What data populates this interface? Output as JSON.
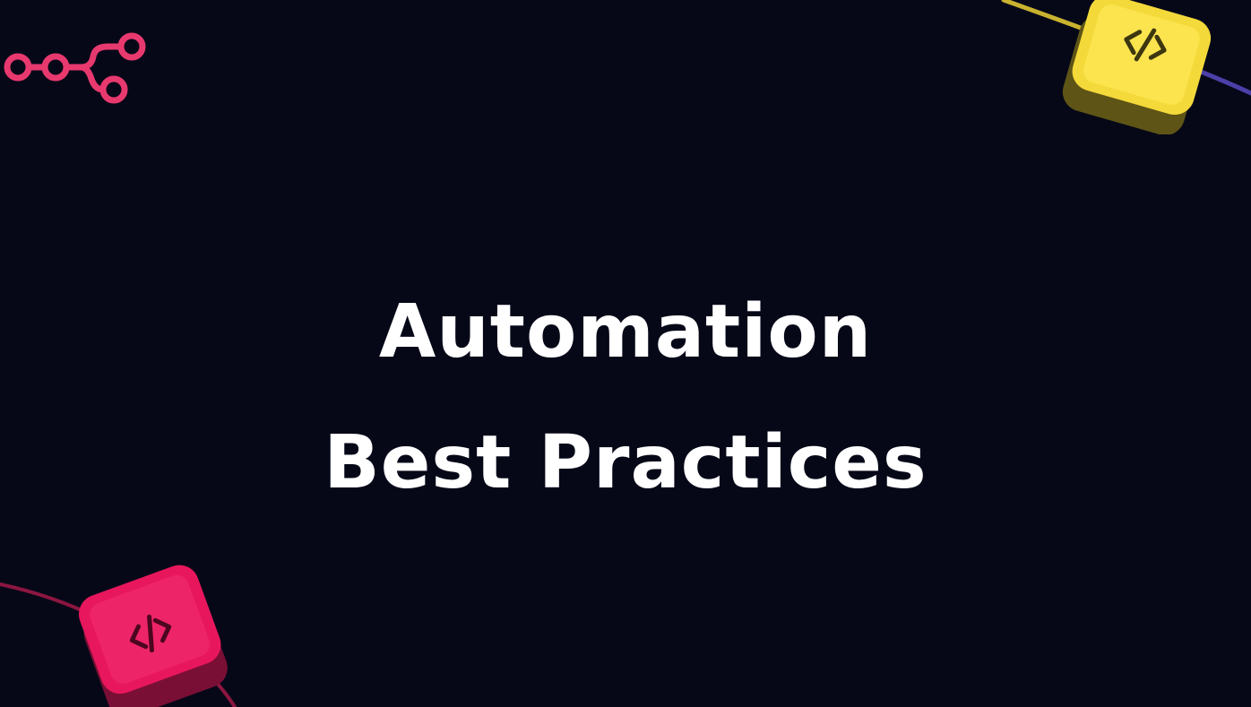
{
  "slide": {
    "title_line_1": "Automation",
    "title_line_2": "Best Practices"
  },
  "colors": {
    "background": "#060818",
    "title_text": "#ffffff",
    "logo": "#e8396f",
    "cube_yellow": "#f4d93a",
    "cube_pink": "#e8175d",
    "orbit_yellow": "#c9b22f",
    "orbit_purple": "#4b3fa8",
    "orbit_pink": "#8c1640"
  },
  "icons": {
    "logo": "workflow-nodes-icon",
    "cube_top": "code-brackets-icon",
    "cube_bottom": "code-brackets-icon"
  }
}
